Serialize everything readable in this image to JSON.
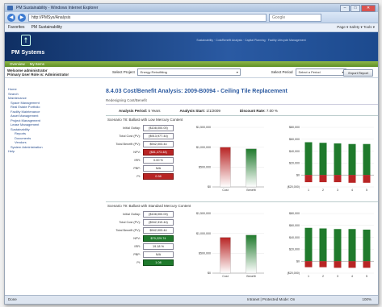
{
  "browser": {
    "window_title": "PM Sustainability - Windows Internet Explorer",
    "url": "http://PMSys/Analysis",
    "search_placeholder": "Google",
    "favorites_label": "Favorites",
    "fav_tab": "PM Sustainability",
    "tools_text": "Page ▾  Safety ▾  Tools ▾",
    "status_text": "Done",
    "zone_text": "Intranet | Protected Mode: On",
    "zoom_text": "100%"
  },
  "app": {
    "brand": "PM Systems",
    "header_note": "Sustainability · Cost/Benefit Analysis · Capital Planning · Facility Lifecycle Management",
    "menu": [
      "Overview",
      "My Items"
    ],
    "user_line1": "Welcome administrator",
    "user_line2": "Primary User Role is: Administrator",
    "project_label": "Select Project",
    "project_value": "Energy Retrofitting",
    "period_label": "Select Period",
    "period_value": "Select a Period",
    "export_label": "Export Report"
  },
  "sidebar": {
    "items": [
      {
        "label": "Home",
        "level": 0
      },
      {
        "label": "Search",
        "level": 0
      },
      {
        "label": "Maintenance",
        "level": 0
      },
      {
        "label": "Space Management",
        "level": 1
      },
      {
        "label": "Real Estate Portfolio",
        "level": 1
      },
      {
        "label": "Facility Maintenance",
        "level": 1
      },
      {
        "label": "Asset Management",
        "level": 1
      },
      {
        "label": "Project Management",
        "level": 1
      },
      {
        "label": "Lease Management",
        "level": 1
      },
      {
        "label": "Sustainability",
        "level": 1
      },
      {
        "label": "Reports",
        "level": 2
      },
      {
        "label": "Documents",
        "level": 2
      },
      {
        "label": "Vendors",
        "level": 2
      },
      {
        "label": "System Administration",
        "level": 1
      },
      {
        "label": "Help",
        "level": 0
      }
    ]
  },
  "page": {
    "title": "8.4.03 Cost/Benefit Analysis: 2009-B0094 - Ceiling Tile Replacement",
    "subtitle": "Redesigning Cost/Benefit",
    "analysis_period_label": "Analysis Period:",
    "analysis_period_value": "5 Years",
    "analysis_start_label": "Analysis Start:",
    "analysis_start_value": "1/1/2009",
    "discount_rate_label": "Discount Rate:",
    "discount_rate_value": "7.00 %"
  },
  "scenarios": [
    {
      "title": "Scenario 78: Ballast with Low Mercury Content",
      "fields": [
        {
          "label": "Initial Outlay:",
          "value": "($108,000.00)",
          "style": "plain"
        },
        {
          "label": "Total Cost (PV):",
          "value": "($913,977.44)",
          "style": "plain"
        },
        {
          "label": "Total Benefit (PV):",
          "value": "$942,003.44",
          "style": "plain"
        },
        {
          "label": "NPV:",
          "value": "($81,473.48)",
          "style": "red"
        },
        {
          "label": "IRR:",
          "value": "0.00 %",
          "style": "plain"
        },
        {
          "label": "PBP:",
          "value": "N/A",
          "style": "plain"
        },
        {
          "label": "PI:",
          "value": "0.98",
          "style": "red"
        }
      ]
    },
    {
      "title": "Scenario 79: Ballast with Standard Mercury Content",
      "fields": [
        {
          "label": "Initial Outlay:",
          "value": "($108,000.00)",
          "style": "plain"
        },
        {
          "label": "Total Cost (PV):",
          "value": "($942,319.44)",
          "style": "plain"
        },
        {
          "label": "Total Benefit (PV):",
          "value": "$942,003.44",
          "style": "plain"
        },
        {
          "label": "NPV:",
          "value": "$70,229.74",
          "style": "green"
        },
        {
          "label": "IRR:",
          "value": "19.18 %",
          "style": "plain"
        },
        {
          "label": "PBP:",
          "value": "N/A",
          "style": "plain"
        },
        {
          "label": "PI:",
          "value": "1.08",
          "style": "green"
        }
      ]
    }
  ],
  "chart_data": [
    {
      "type": "bar",
      "categories": [
        "Cost",
        "Benefit"
      ],
      "values": [
        1000000,
        960000
      ],
      "colors": [
        "#b82424",
        "#1f7a2c"
      ],
      "ytick_labels": [
        "$1,500,000",
        "$1,000,000",
        "$500,000",
        "$0"
      ],
      "ylim": [
        0,
        1500000
      ]
    },
    {
      "type": "bar",
      "categories": [
        "1",
        "2",
        "3",
        "4",
        "5"
      ],
      "series": [
        {
          "values": [
            55000,
            54000,
            53000,
            52000,
            52000
          ],
          "color": "#1f7a2c"
        },
        {
          "values": [
            -12000,
            -12000,
            -12000,
            -13000,
            -13000
          ],
          "color": "#b82424"
        }
      ],
      "ytick_labels": [
        "$80,000",
        "$60,000",
        "$40,000",
        "$20,000",
        "$0",
        "($20,000)"
      ],
      "ylim": [
        -20000,
        80000
      ]
    },
    {
      "type": "bar",
      "categories": [
        "Cost",
        "Benefit"
      ],
      "values": [
        900000,
        960000
      ],
      "colors": [
        "#b82424",
        "#1f7a2c"
      ],
      "ytick_labels": [
        "$1,500,000",
        "$1,000,000",
        "$500,000",
        "$0"
      ],
      "ylim": [
        0,
        1500000
      ]
    },
    {
      "type": "bar",
      "categories": [
        "1",
        "2",
        "3",
        "4",
        "5"
      ],
      "series": [
        {
          "values": [
            56000,
            55000,
            54000,
            54000,
            53000
          ],
          "color": "#1f7a2c"
        },
        {
          "values": [
            -10000,
            -10000,
            -11000,
            -11000,
            -11000
          ],
          "color": "#b82424"
        }
      ],
      "ytick_labels": [
        "$80,000",
        "$60,000",
        "$40,000",
        "$20,000",
        "$0",
        "($20,000)"
      ],
      "ylim": [
        -20000,
        80000
      ]
    }
  ]
}
